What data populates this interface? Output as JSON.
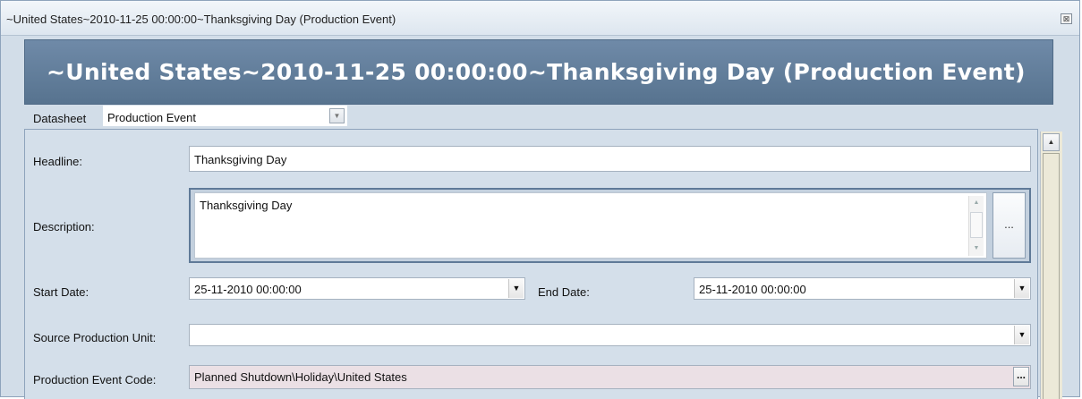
{
  "window": {
    "title": "~United States~2010-11-25 00:00:00~Thanksgiving Day (Production Event)",
    "close_glyph": "⊠"
  },
  "banner": {
    "title": "~United States~2010-11-25 00:00:00~Thanksgiving Day (Production Event)"
  },
  "datasheet": {
    "label": "Datasheet",
    "value": "Production Event",
    "arrow_glyph": "▼"
  },
  "form": {
    "headline": {
      "label": "Headline:",
      "value": "Thanksgiving Day"
    },
    "description": {
      "label": "Description:",
      "value": "Thanksgiving Day",
      "more_label": "..."
    },
    "start_date": {
      "label": "Start Date:",
      "value": "25-11-2010 00:00:00"
    },
    "end_date": {
      "label": "End Date:",
      "value": "25-11-2010 00:00:00"
    },
    "source_production_unit": {
      "label": "Source Production Unit:",
      "value": ""
    },
    "production_event_code": {
      "label": "Production Event Code:",
      "value": "Planned Shutdown\\Holiday\\United States",
      "more_label": "..."
    }
  },
  "glyphs": {
    "dropdown": "▼",
    "scroll_up": "▲",
    "scroll_down": "▼"
  },
  "colors": {
    "banner": "#6a86a3",
    "panel_bg": "#d4dfea",
    "readonly_field": "#ebe0e5"
  }
}
